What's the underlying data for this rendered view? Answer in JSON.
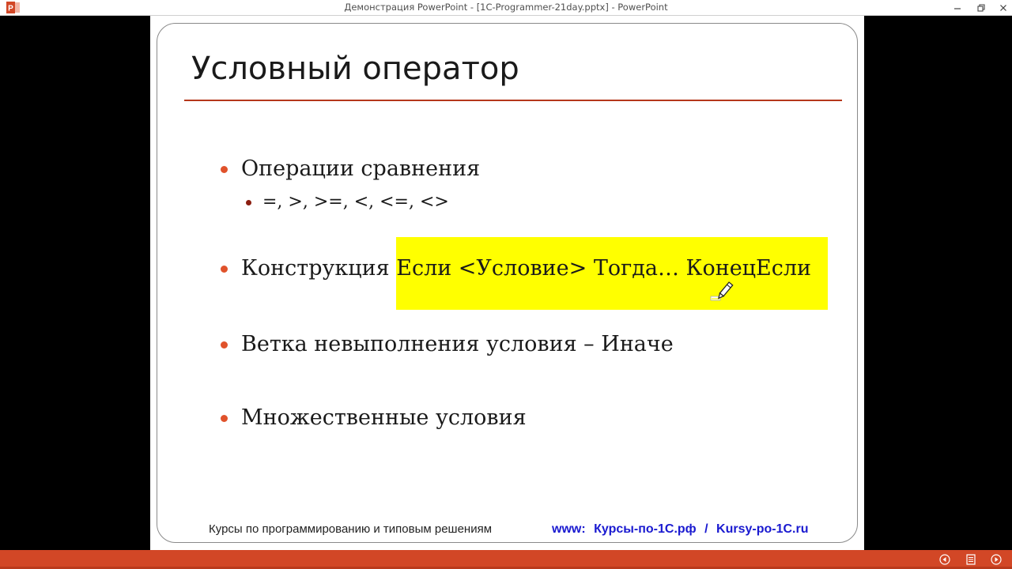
{
  "window": {
    "title": "Демонстрация PowerPoint - [1C-Programmer-21day.pptx] - PowerPoint",
    "app_icon": "powerpoint-icon",
    "controls": [
      "minimize-icon",
      "restore-icon",
      "close-icon"
    ]
  },
  "slide": {
    "title": "Условный оператор",
    "bullets": [
      {
        "text": "Операции сравнения"
      },
      {
        "text": "=, >, >=, <, <=, <>"
      },
      {
        "text_before": "Конструкция ",
        "text_highlight": "Если <Условие> Тогда… КонецЕсли"
      },
      {
        "text": "Ветка невыполнения условия – Иначе"
      },
      {
        "text": "Множественные условия"
      }
    ],
    "highlight_color": "#ffff00",
    "accent_color": "#d24726",
    "footer": {
      "text": "Курсы по программированию и типовым решениям",
      "links": [
        "www:",
        "Курсы-по-1С.рф",
        "/",
        "Kursy-po-1C.ru"
      ]
    }
  },
  "slideshow_controls": {
    "previous": "previous-slide-icon",
    "menu": "slide-menu-icon",
    "next": "next-slide-icon"
  },
  "cursor": "pen-cursor-icon"
}
